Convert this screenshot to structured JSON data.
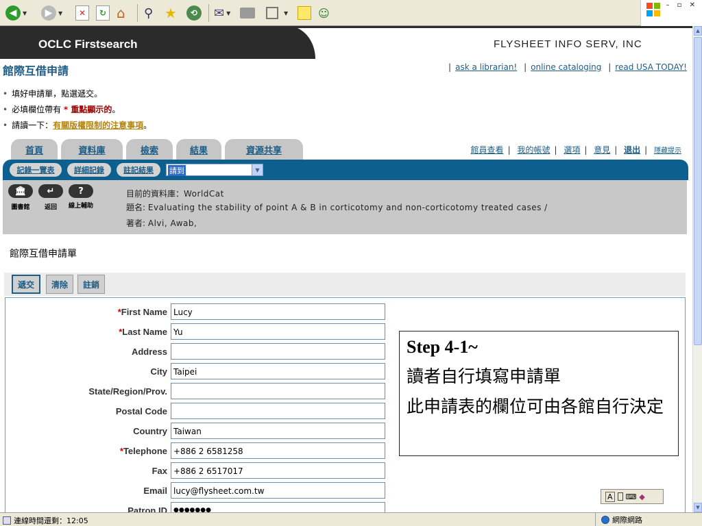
{
  "browser": {
    "toolbar": {
      "icons": [
        "back-icon",
        "forward-icon",
        "stop-icon",
        "refresh-icon",
        "home-icon",
        "search-icon",
        "favorites-icon",
        "history-icon",
        "mail-icon",
        "print-icon",
        "edit-icon",
        "notes-icon",
        "messenger-icon"
      ]
    }
  },
  "header": {
    "brand": "OCLC Firstsearch",
    "institution": "FLYSHEET INFO SERV, INC"
  },
  "page": {
    "title": "館際互借申請",
    "top_links": [
      "ask a librarian!",
      "online cataloging",
      "read USA TODAY!"
    ]
  },
  "notes": {
    "line1": "填好申請單，點選遞交。",
    "line2_prefix": "必填欄位帶有 ",
    "line2_star": "*",
    "line2_highlight": " 重點顯示的",
    "line2_suffix": "。",
    "line3_prefix": "請讀一下：",
    "line3_link": "有關版權限制的注意事項",
    "line3_suffix": "。"
  },
  "tabs": [
    "首頁",
    "資料庫",
    "檢索",
    "結果",
    "資源共享"
  ],
  "right_links": [
    "館員查看",
    "我的帳號",
    "選項",
    "意見",
    "退出",
    "隱藏提示"
  ],
  "subbar": {
    "buttons": [
      "記錄一覽表",
      "詳細記錄",
      "註記結果"
    ],
    "select_value": "請到"
  },
  "info": {
    "icons": [
      {
        "symbol": "🏛",
        "label": "圖書館"
      },
      {
        "symbol": "↵",
        "label": "返回"
      },
      {
        "symbol": "?",
        "label": "線上輔助"
      }
    ],
    "db_label": "目前的資料庫：",
    "db_value": "WorldCat",
    "title_label": "題名: ",
    "title_value": "Evaluating the stability of point A & B in corticotomy and non-corticotomy treated cases /",
    "author_label": "著者: ",
    "author_value": "Alvi, Awab,"
  },
  "form": {
    "title": "館際互借申請單",
    "actions": [
      "遞交",
      "清除",
      "註銷"
    ],
    "fields": [
      {
        "label": "First Name",
        "required": true,
        "value": "Lucy"
      },
      {
        "label": "Last Name",
        "required": true,
        "value": "Yu"
      },
      {
        "label": "Address",
        "required": false,
        "value": ""
      },
      {
        "label": "City",
        "required": false,
        "value": "Taipei"
      },
      {
        "label": "State/Region/Prov.",
        "required": false,
        "value": ""
      },
      {
        "label": "Postal Code",
        "required": false,
        "value": ""
      },
      {
        "label": "Country",
        "required": false,
        "value": "Taiwan"
      },
      {
        "label": "Telephone",
        "required": true,
        "value": "+886 2 6581258"
      },
      {
        "label": "Fax",
        "required": false,
        "value": "+886 2 6517017"
      },
      {
        "label": "Email",
        "required": false,
        "value": "lucy@flysheet.com.tw"
      },
      {
        "label": "Patron ID",
        "required": false,
        "value": "●●●●●●●"
      }
    ]
  },
  "annotation": {
    "step": "Step 4-1~",
    "line1": "讀者自行填寫申請單",
    "line2": "此申請表的欄位可由各館自行決定"
  },
  "status": {
    "left": "連線時間還剩：12:05",
    "zone": "網際網路"
  },
  "colors": {
    "accent_blue": "#0d5f8f",
    "link_blue": "#1d5d85",
    "header_dark": "#2b2b2b",
    "required_red": "#cc0000"
  }
}
